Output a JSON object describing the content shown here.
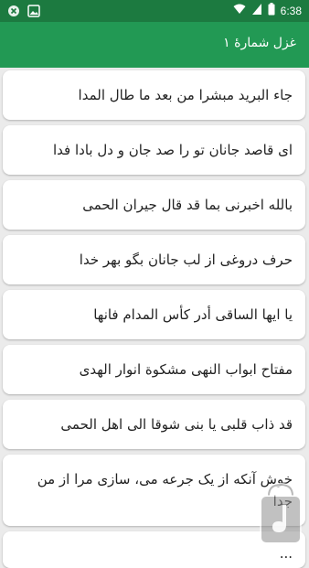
{
  "status_bar": {
    "time": "6:38",
    "icons": [
      "close-notification-icon",
      "image-notification-icon",
      "wifi-icon",
      "signal-icon",
      "battery-icon"
    ]
  },
  "app_bar": {
    "title": "غزل شمارهٔ ۱",
    "color": "#229954",
    "status_color": "#1c7a40"
  },
  "verses": [
    "جاء البرید مبشرا من بعد ما طال المدا",
    "ای قاصد جانان تو را صد جان و دل بادا فدا",
    "بالله اخبرنی بما قد قال جیران الحمی",
    "حرف دروغی از لب جانان بگو بهر خدا",
    "یا ایها الساقی أدر کأس المدام فانها",
    "مفتاح ابواب النهی مشکوة انوار الهدی",
    "قد ذاب قلبی یا بنی شوقا الی اهل الحمی",
    "خوش آنکه از یک جرعه می، سازی مرا از من جدا",
    "..."
  ]
}
